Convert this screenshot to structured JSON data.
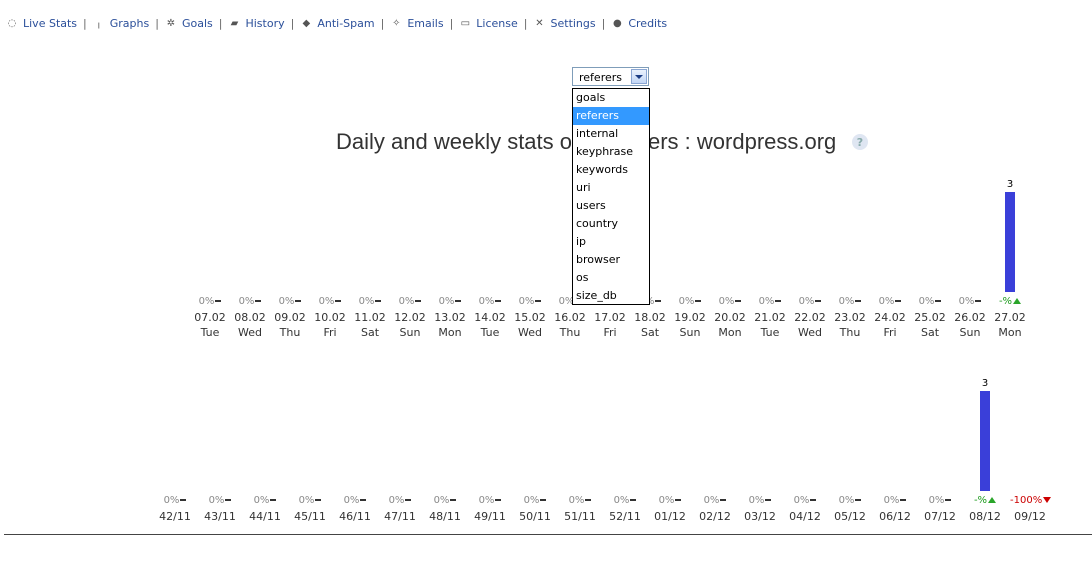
{
  "nav": [
    {
      "label": "Live Stats",
      "icon": "globe-icon",
      "glyph": "◌"
    },
    {
      "label": "Graphs",
      "icon": "bar-graph-icon",
      "glyph": "╷"
    },
    {
      "label": "Goals",
      "icon": "goals-icon",
      "glyph": "✲"
    },
    {
      "label": "History",
      "icon": "book-icon",
      "glyph": "▰"
    },
    {
      "label": "Anti-Spam",
      "icon": "shield-icon",
      "glyph": "◆"
    },
    {
      "label": "Emails",
      "icon": "envelope-icon",
      "glyph": "✧"
    },
    {
      "label": "License",
      "icon": "license-icon",
      "glyph": "▭"
    },
    {
      "label": "Settings",
      "icon": "tools-icon",
      "glyph": "✕"
    },
    {
      "label": "Credits",
      "icon": "user-icon",
      "glyph": "●"
    }
  ],
  "selector": {
    "value": "referers",
    "options": [
      "goals",
      "referers",
      "internal",
      "keyphrase",
      "keywords",
      "uri",
      "users",
      "country",
      "ip",
      "browser",
      "os",
      "size_db"
    ],
    "selected_index": 1
  },
  "title": "Daily and weekly stats of referers : wordpress.org",
  "title_visible": "Daily and weekly stats o",
  "title_visible_tail": "ers : wordpress.org",
  "help_glyph": "?",
  "chart_data": [
    {
      "type": "bar",
      "title": "",
      "categories": [
        "07.02",
        "08.02",
        "09.02",
        "10.02",
        "11.02",
        "12.02",
        "13.02",
        "14.02",
        "15.02",
        "16.02",
        "17.02",
        "18.02",
        "19.02",
        "20.02",
        "21.02",
        "22.02",
        "23.02",
        "24.02",
        "25.02",
        "26.02",
        "27.02"
      ],
      "days": [
        "Tue",
        "Wed",
        "Thu",
        "Fri",
        "Sat",
        "Sun",
        "Mon",
        "Tue",
        "Wed",
        "Thu",
        "Fri",
        "Sat",
        "Sun",
        "Mon",
        "Tue",
        "Wed",
        "Thu",
        "Fri",
        "Sat",
        "Sun",
        "Mon"
      ],
      "values": [
        0,
        0,
        0,
        0,
        0,
        0,
        0,
        0,
        0,
        0,
        0,
        0,
        0,
        0,
        0,
        0,
        0,
        0,
        0,
        0,
        3
      ],
      "changes": [
        "0%",
        "0%",
        "0%",
        "0%",
        "0%",
        "0%",
        "0%",
        "0%",
        "0%",
        "0%",
        "0%",
        "0%",
        "0%",
        "0%",
        "0%",
        "0%",
        "0%",
        "0%",
        "0%",
        "0%",
        "-%"
      ],
      "trends": [
        "flat",
        "flat",
        "flat",
        "flat",
        "flat",
        "flat",
        "flat",
        "flat",
        "flat",
        "flat",
        "flat",
        "flat",
        "flat",
        "flat",
        "flat",
        "flat",
        "flat",
        "flat",
        "flat",
        "flat",
        "up"
      ],
      "bar_color": "#3a3fd9",
      "ylim": [
        0,
        3
      ]
    },
    {
      "type": "bar",
      "title": "",
      "categories": [
        "42/11",
        "43/11",
        "44/11",
        "45/11",
        "46/11",
        "47/11",
        "48/11",
        "49/11",
        "50/11",
        "51/11",
        "52/11",
        "01/12",
        "02/12",
        "03/12",
        "04/12",
        "05/12",
        "06/12",
        "07/12",
        "08/12",
        "09/12"
      ],
      "values": [
        0,
        0,
        0,
        0,
        0,
        0,
        0,
        0,
        0,
        0,
        0,
        0,
        0,
        0,
        0,
        0,
        0,
        0,
        3,
        0
      ],
      "changes": [
        "0%",
        "0%",
        "0%",
        "0%",
        "0%",
        "0%",
        "0%",
        "0%",
        "0%",
        "0%",
        "0%",
        "0%",
        "0%",
        "0%",
        "0%",
        "0%",
        "0%",
        "0%",
        "-%",
        "-100%"
      ],
      "trends": [
        "flat",
        "flat",
        "flat",
        "flat",
        "flat",
        "flat",
        "flat",
        "flat",
        "flat",
        "flat",
        "flat",
        "flat",
        "flat",
        "flat",
        "flat",
        "flat",
        "flat",
        "flat",
        "up",
        "down"
      ],
      "bar_color": "#3a3fd9",
      "ylim": [
        0,
        3
      ]
    }
  ]
}
